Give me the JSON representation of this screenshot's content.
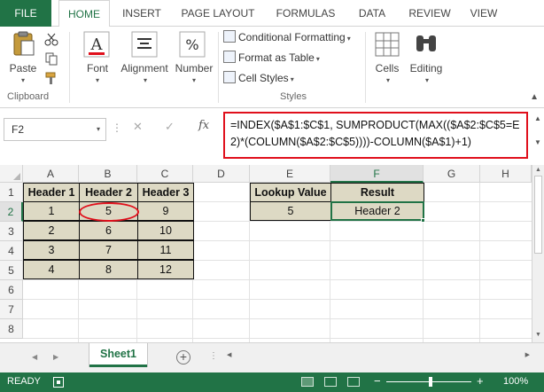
{
  "ribbon_tabs": [
    "FILE",
    "HOME",
    "INSERT",
    "PAGE LAYOUT",
    "FORMULAS",
    "DATA",
    "REVIEW",
    "VIEW"
  ],
  "active_tab": "HOME",
  "clipboard": {
    "paste_label": "Paste",
    "group_label": "Clipboard"
  },
  "font_group": {
    "label": "Font"
  },
  "alignment_group": {
    "label": "Alignment"
  },
  "number_group": {
    "label": "Number"
  },
  "styles": {
    "conditional_formatting": "Conditional Formatting",
    "format_as_table": "Format as Table",
    "cell_styles": "Cell Styles",
    "group_label": "Styles"
  },
  "cells_group": {
    "label": "Cells"
  },
  "editing_group": {
    "label": "Editing"
  },
  "name_box": "F2",
  "formula": "=INDEX($A$1:$C$1, SUMPRODUCT(MAX(($A$2:$C$5=E2)*(COLUMN($A$2:$C$5))))-COLUMN($A$1)+1)",
  "columns": [
    "A",
    "B",
    "C",
    "D",
    "E",
    "F",
    "G",
    "H"
  ],
  "rows": [
    "1",
    "2",
    "3",
    "4",
    "5",
    "6",
    "7",
    "8"
  ],
  "selected_column": "F",
  "selected_row": "2",
  "table": {
    "headers": [
      "Header 1",
      "Header 2",
      "Header 3"
    ],
    "rows": [
      [
        "1",
        "5",
        "9"
      ],
      [
        "2",
        "6",
        "10"
      ],
      [
        "3",
        "7",
        "11"
      ],
      [
        "4",
        "8",
        "12"
      ]
    ]
  },
  "lookup": {
    "value_header": "Lookup Value",
    "result_header": "Result",
    "value": "5",
    "result": "Header 2"
  },
  "sheet_tab": "Sheet1",
  "status": {
    "ready": "READY",
    "zoom": "100%"
  },
  "colors": {
    "excel_green": "#217346",
    "table_fill": "#ddd9c4",
    "highlight_red": "#e0101c"
  }
}
